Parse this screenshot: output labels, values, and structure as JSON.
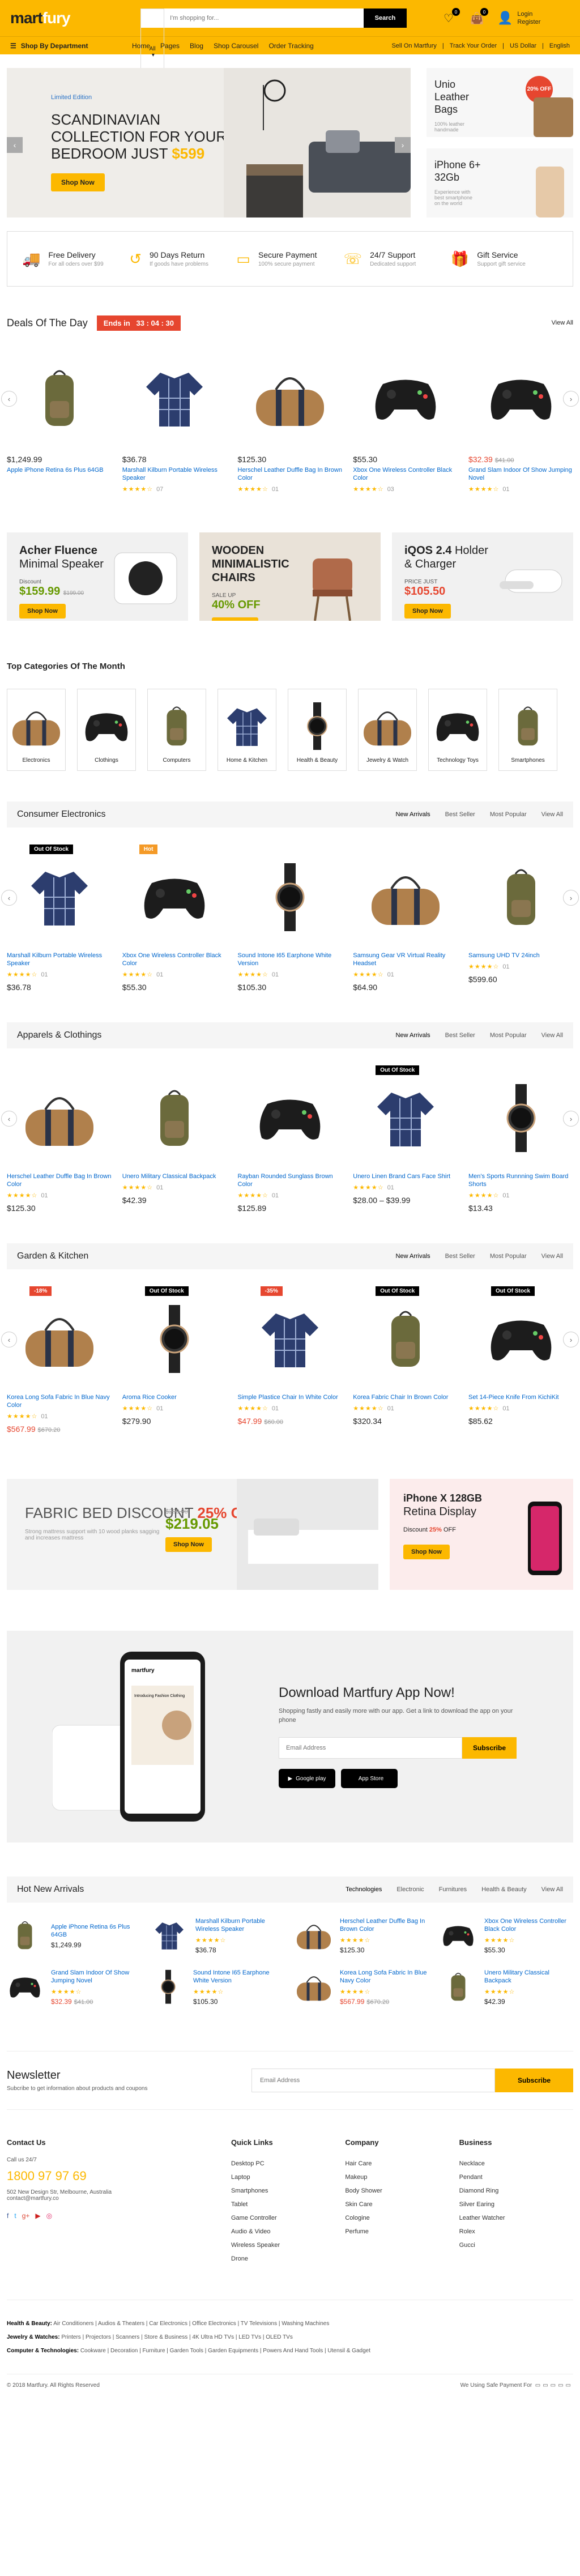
{
  "header": {
    "logo_a": "mart",
    "logo_b": "fury",
    "search_cat": "All",
    "search_placeholder": "I'm shopping for...",
    "search_btn": "Search",
    "wish_count": "0",
    "cart_count": "0",
    "login": "Login",
    "register": "Register"
  },
  "nav": {
    "dept": "Shop By Department",
    "links": [
      "Home",
      "Pages",
      "Blog",
      "Shop Carousel",
      "Order Tracking"
    ],
    "right": [
      "Sell On Martfury",
      "Track Your Order",
      "US Dollar",
      "English"
    ]
  },
  "hero": {
    "small": "Limited Edition",
    "title": "SCANDINAVIAN COLLECTION FOR YOUR BEDROOM JUST",
    "price": "$599",
    "btn": "Shop Now",
    "b1_title": "Unio Leather Bags",
    "b1_desc": "100% leather handmade",
    "b1_badge": "20% OFF",
    "b2_title": "iPhone 6+ 32Gb",
    "b2_desc": "Experience with best smartphone on the world"
  },
  "features": [
    {
      "icon": "🚚",
      "t": "Free Delivery",
      "s": "For all oders over $99"
    },
    {
      "icon": "↺",
      "t": "90 Days Return",
      "s": "If goods have problems"
    },
    {
      "icon": "▭",
      "t": "Secure Payment",
      "s": "100% secure payment"
    },
    {
      "icon": "☏",
      "t": "24/7 Support",
      "s": "Dedicated support"
    },
    {
      "icon": "🎁",
      "t": "Gift Service",
      "s": "Support gift service"
    }
  ],
  "deals": {
    "title": "Deals Of The Day",
    "ends": "Ends in",
    "timer": "33 : 04 : 30",
    "view_all": "View All",
    "items": [
      {
        "img": "backpack",
        "price": "$1,249.99",
        "name": "Apple iPhone Retina 6s Plus 64GB",
        "stars": "",
        "rev": ""
      },
      {
        "img": "shirt",
        "price": "$36.78",
        "name": "Marshall Kilburn Portable Wireless Speaker",
        "stars": "★★★★☆",
        "rev": "07"
      },
      {
        "img": "duffel",
        "price": "$125.30",
        "name": "Herschel Leather Duffle Bag In Brown Color",
        "stars": "★★★★☆",
        "rev": "01"
      },
      {
        "img": "controller",
        "price": "$55.30",
        "name": "Xbox One Wireless Controller Black Color",
        "stars": "★★★★☆",
        "rev": "03"
      },
      {
        "img": "controller",
        "price": "$32.39",
        "old": "$41.00",
        "name": "Grand Slam Indoor Of Show Jumping Novel",
        "stars": "★★★★☆",
        "rev": "01",
        "sale": true
      }
    ]
  },
  "promos": [
    {
      "t1": "Acher Fluence",
      "t2": "Minimal Speaker",
      "lbl": "Discount",
      "val": "$159.99",
      "old": "$199.00",
      "btn": "Shop Now"
    },
    {
      "t1": "WOODEN MINIMALISTIC CHAIRS",
      "lbl": "SALE UP",
      "val": "40% OFF",
      "btn": "Shop Now"
    },
    {
      "t1": "iQOS 2.4",
      "t2": "Holder & Charger",
      "lbl": "PRICE JUST",
      "val": "$105.50",
      "btn": "Shop Now"
    }
  ],
  "top_cats": {
    "title": "Top Categories Of The Month",
    "items": [
      {
        "img": "duffel",
        "n": "Electronics"
      },
      {
        "img": "controller",
        "n": "Clothings"
      },
      {
        "img": "backpack",
        "n": "Computers"
      },
      {
        "img": "shirt",
        "n": "Home & Kitchen"
      },
      {
        "img": "watch",
        "n": "Health & Beauty"
      },
      {
        "img": "duffel",
        "n": "Jewelry & Watch"
      },
      {
        "img": "controller",
        "n": "Technology Toys"
      },
      {
        "img": "backpack",
        "n": "Smartphones"
      }
    ]
  },
  "tabs": [
    "New Arrivals",
    "Best Seller",
    "Most Popular",
    "View All"
  ],
  "sections": [
    {
      "title": "Consumer Electronics",
      "items": [
        {
          "img": "shirt",
          "badge": "Out Of Stock",
          "name": "Marshall Kilburn Portable Wireless Speaker",
          "stars": "★★★★☆",
          "rev": "01",
          "price": "$36.78"
        },
        {
          "img": "controller",
          "hot": "Hot",
          "name": "Xbox One Wireless Controller Black Color",
          "stars": "★★★★☆",
          "rev": "01",
          "price": "$55.30"
        },
        {
          "img": "watch",
          "name": "Sound Intone I65 Earphone White Version",
          "stars": "★★★★☆",
          "rev": "01",
          "price": "$105.30"
        },
        {
          "img": "duffel",
          "name": "Samsung Gear VR Virtual Reality Headset",
          "stars": "★★★★☆",
          "rev": "01",
          "price": "$64.90"
        },
        {
          "img": "backpack",
          "name": "Samsung UHD TV 24inch",
          "stars": "★★★★☆",
          "rev": "01",
          "price": "$599.60"
        }
      ]
    },
    {
      "title": "Apparels & Clothings",
      "items": [
        {
          "img": "duffel",
          "name": "Herschel Leather Duffle Bag In Brown Color",
          "stars": "★★★★☆",
          "rev": "01",
          "price": "$125.30"
        },
        {
          "img": "backpack",
          "name": "Unero Military Classical Backpack",
          "stars": "★★★★☆",
          "rev": "01",
          "price": "$42.39"
        },
        {
          "img": "controller",
          "name": "Rayban Rounded Sunglass Brown Color",
          "stars": "★★★★☆",
          "rev": "01",
          "price": "$125.89"
        },
        {
          "img": "shirt",
          "badge": "Out Of Stock",
          "name": "Unero Linen Brand Cars Face Shirt",
          "stars": "★★★★☆",
          "rev": "01",
          "price": "$28.00 – $39.99"
        },
        {
          "img": "watch",
          "name": "Men's Sports Runnning Swim Board Shorts",
          "stars": "★★★★☆",
          "rev": "01",
          "price": "$13.43"
        }
      ]
    },
    {
      "title": "Garden & Kitchen",
      "items": [
        {
          "img": "duffel",
          "disc": "-18%",
          "name": "Korea Long Sofa Fabric In Blue Navy Color",
          "stars": "★★★★☆",
          "rev": "01",
          "price": "$567.99",
          "old": "$670.20",
          "sale": true
        },
        {
          "img": "watch",
          "badge": "Out Of Stock",
          "name": "Aroma Rice Cooker",
          "stars": "★★★★☆",
          "rev": "01",
          "price": "$279.90"
        },
        {
          "img": "shirt",
          "disc": "-35%",
          "name": "Simple Plastice Chair In White Color",
          "stars": "★★★★☆",
          "rev": "01",
          "price": "$47.99",
          "old": "$60.00",
          "sale": true
        },
        {
          "img": "backpack",
          "badge": "Out Of Stock",
          "name": "Korea Fabric Chair In Brown Color",
          "stars": "★★★★☆",
          "rev": "01",
          "price": "$320.34"
        },
        {
          "img": "controller",
          "badge": "Out Of Stock",
          "name": "Set 14-Piece Knife From KichiKit",
          "stars": "★★★★☆",
          "rev": "01",
          "price": "$85.62"
        }
      ]
    }
  ],
  "banner_pair": {
    "t1": "FABRIC BED DISCOUNT",
    "t1_off": "25% OFF",
    "d1": "Strong mattress support with 10 wood planks sagging and increases mattress",
    "old": "$299.00",
    "price": "$219.05",
    "btn": "Shop Now",
    "t2a": "iPhone X 128GB",
    "t2b": "Retina Display",
    "lbl": "Discount",
    "off": "25%",
    "off2": "OFF",
    "btn2": "Shop Now"
  },
  "download": {
    "title": "Download Martfury App Now!",
    "desc": "Shopping fastly and easily more with our app. Get a link to download the app on your phone",
    "placeholder": "Email Address",
    "btn": "Subscribe",
    "gp": "Google play",
    "as": "App Store",
    "phone_text": "Introducing Fashion Clothing",
    "phone_brand": "martfury"
  },
  "hot": {
    "title": "Hot New Arrivals",
    "tabs": [
      "Technologies",
      "Electronic",
      "Furnitures",
      "Health & Beauty",
      "View All"
    ],
    "items": [
      {
        "img": "backpack",
        "name": "Apple iPhone Retina 6s Plus 64GB",
        "price": "$1,249.99"
      },
      {
        "img": "shirt",
        "name": "Marshall Kilburn Portable Wireless Speaker",
        "price": "$36.78",
        "stars": "★★★★☆"
      },
      {
        "img": "duffel",
        "name": "Herschel Leather Duffle Bag In Brown Color",
        "price": "$125.30",
        "stars": "★★★★☆"
      },
      {
        "img": "controller",
        "name": "Xbox One Wireless Controller Black Color",
        "price": "$55.30",
        "stars": "★★★★☆"
      },
      {
        "img": "controller",
        "name": "Grand Slam Indoor Of Show Jumping Novel",
        "price": "$32.39",
        "old": "$41.00",
        "stars": "★★★★☆",
        "sale": true
      },
      {
        "img": "watch",
        "name": "Sound Intone I65 Earphone White Version",
        "price": "$105.30",
        "stars": "★★★★☆"
      },
      {
        "img": "duffel",
        "name": "Korea Long Sofa Fabric In Blue Navy Color",
        "price": "$567.99",
        "old": "$670.20",
        "stars": "★★★★☆",
        "sale": true
      },
      {
        "img": "backpack",
        "name": "Unero Military Classical Backpack",
        "price": "$42.39",
        "stars": "★★★★☆"
      }
    ]
  },
  "newsletter": {
    "title": "Newsletter",
    "desc": "Subcribe to get information about products and coupons",
    "placeholder": "Email Address",
    "btn": "Subscribe"
  },
  "footer": {
    "contact": "Contact Us",
    "call": "Call us 24/7",
    "phone": "1800 97 97 69",
    "addr": "502 New Design Str, Melbourne, Australia",
    "mail": "contact@martfury.co",
    "social": [
      "f",
      "t",
      "g+",
      "▶",
      "◎"
    ],
    "cols": [
      {
        "h": "Quick Links",
        "l": [
          "Desktop PC",
          "Laptop",
          "Smartphones",
          "Tablet",
          "Game Controller",
          "Audio & Video",
          "Wireless Speaker",
          "Drone"
        ]
      },
      {
        "h": "Company",
        "l": [
          "Hair Care",
          "Makeup",
          "Body Shower",
          "Skin Care",
          "Cologine",
          "Perfume"
        ]
      },
      {
        "h": "Business",
        "l": [
          "Necklace",
          "Pendant",
          "Diamond Ring",
          "Silver Earing",
          "Leather Watcher",
          "Rolex",
          "Gucci"
        ]
      }
    ],
    "links": [
      {
        "b": "Health & Beauty:",
        "t": "Air Conditioners | Audios & Theaters | Car Electronics | Office Electronics | TV Televisions | Washing Machines"
      },
      {
        "b": "Jewelry & Watches:",
        "t": "Printers | Projectors | Scanners | Store & Business | 4K Ultra HD TVs | LED TVs | OLED TVs"
      },
      {
        "b": "Computer & Technologies:",
        "t": "Cookware | Decoration | Furniture | Garden Tools | Garden Equipments | Powers And Hand Tools | Utensil & Gadget"
      }
    ],
    "copy": "© 2018 Martfury. All Rights Reserved",
    "pay": "We Using Safe Payment For"
  }
}
